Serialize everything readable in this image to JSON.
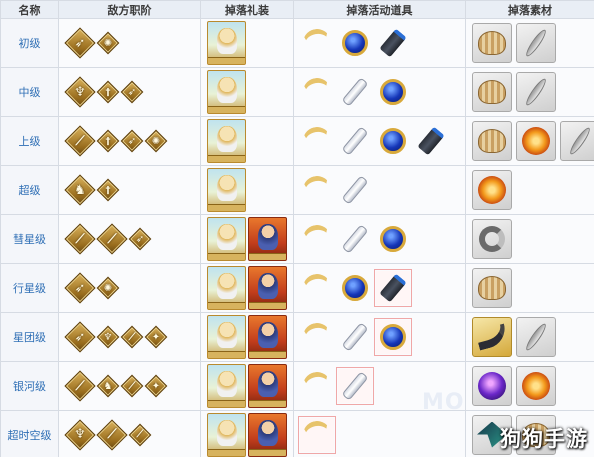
{
  "headers": [
    "名称",
    "敌方职阶",
    "掉落礼装",
    "掉落活动道具",
    "掉落素材"
  ],
  "rows": [
    {
      "name": "初级",
      "classes": [
        "archer",
        "caster"
      ],
      "ce": [
        "ce-a"
      ],
      "items": [
        "crescent",
        "blue-gem",
        "battery"
      ],
      "highlight": [],
      "materials": [
        "shell",
        "feather"
      ]
    },
    {
      "name": "中级",
      "classes": [
        "berserker",
        "saber",
        "archer"
      ],
      "ce": [
        "ce-a"
      ],
      "items": [
        "crescent",
        "flask",
        "blue-gem"
      ],
      "highlight": [],
      "materials": [
        "shell",
        "feather"
      ]
    },
    {
      "name": "上级",
      "classes": [
        "lancer",
        "saber",
        "archer",
        "caster"
      ],
      "ce": [
        "ce-a"
      ],
      "items": [
        "crescent",
        "flask",
        "blue-gem",
        "battery"
      ],
      "highlight": [],
      "materials": [
        "shell",
        "flame",
        "feather"
      ]
    },
    {
      "name": "超级",
      "classes": [
        "rider",
        "saber"
      ],
      "ce": [
        "ce-a"
      ],
      "items": [
        "crescent",
        "flask"
      ],
      "highlight": [],
      "materials": [
        "flame"
      ]
    },
    {
      "name": "彗星级",
      "classes": [
        "lancer",
        "lancer",
        "archer"
      ],
      "ce": [
        "ce-a",
        "ce-b"
      ],
      "items": [
        "crescent",
        "flask",
        "blue-gem"
      ],
      "highlight": [],
      "materials": [
        "ring"
      ]
    },
    {
      "name": "行星级",
      "classes": [
        "archer",
        "caster"
      ],
      "ce": [
        "ce-a",
        "ce-b"
      ],
      "items": [
        "crescent",
        "blue-gem",
        "battery"
      ],
      "highlight": [
        "battery"
      ],
      "materials": [
        "shell"
      ]
    },
    {
      "name": "星团级",
      "classes": [
        "archer",
        "berserker",
        "lancer",
        "assassin"
      ],
      "ce": [
        "ce-a",
        "ce-b"
      ],
      "items": [
        "crescent",
        "flask",
        "blue-gem"
      ],
      "highlight": [
        "blue-gem"
      ],
      "materials": [
        "fang",
        "feather"
      ]
    },
    {
      "name": "银河级",
      "classes": [
        "lancer",
        "rider",
        "lancer",
        "assassin"
      ],
      "ce": [
        "ce-a",
        "ce-b"
      ],
      "items": [
        "crescent",
        "flask"
      ],
      "highlight": [
        "flask"
      ],
      "materials": [
        "orb",
        "flame"
      ]
    },
    {
      "name": "超时空级",
      "classes": [
        "berserker",
        "lancer",
        "lancer"
      ],
      "ce": [
        "ce-a",
        "ce-b"
      ],
      "items": [
        "crescent"
      ],
      "highlight": [
        "crescent"
      ],
      "materials": [
        "leaf",
        "shell"
      ]
    }
  ],
  "watermark": "狗狗手游",
  "background_mark": "MO"
}
